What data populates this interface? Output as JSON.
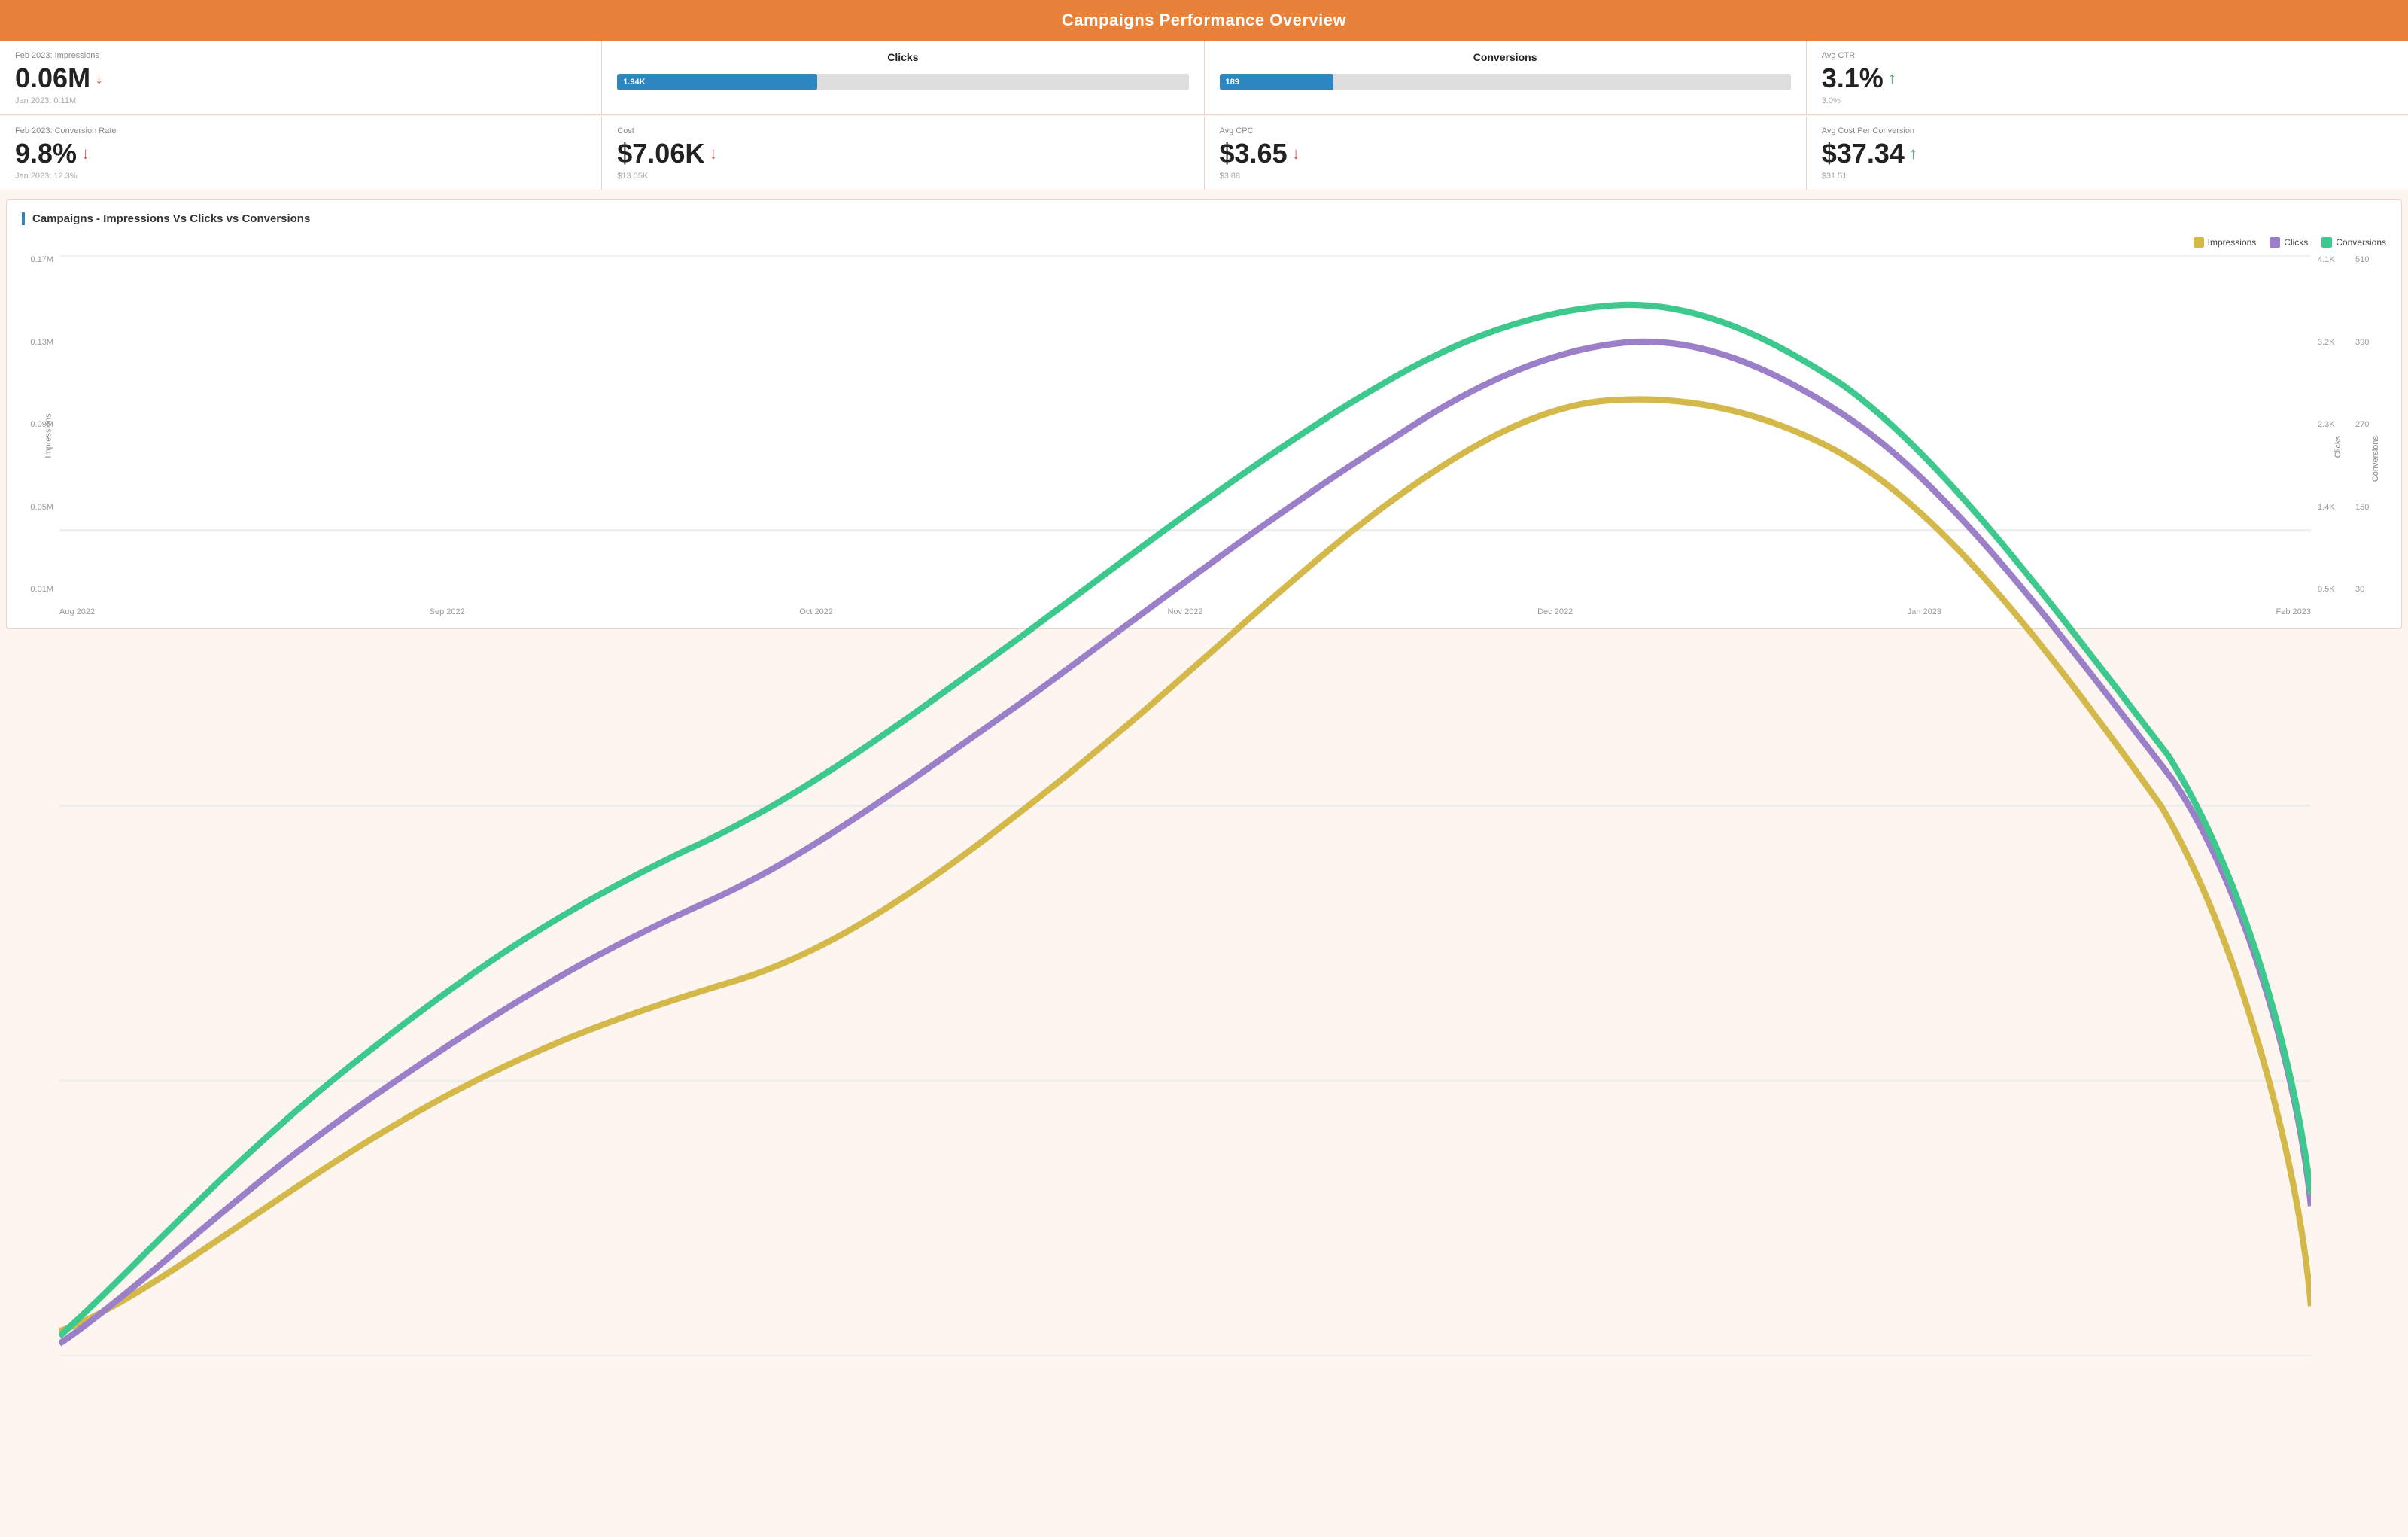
{
  "header": {
    "title": "Campaigns Performance Overview"
  },
  "metrics_row1": [
    {
      "id": "impressions",
      "label": "Feb 2023: Impressions",
      "value": "0.06M",
      "arrow": "down",
      "sub": "Jan 2023: 0.11M",
      "type": "text"
    },
    {
      "id": "clicks",
      "label": "Clicks",
      "bar_value": "1.94K",
      "bar_pct": 35,
      "type": "bar"
    },
    {
      "id": "conversions",
      "label": "Conversions",
      "bar_value": "189",
      "bar_pct": 20,
      "type": "bar"
    },
    {
      "id": "avg_ctr",
      "label": "Avg CTR",
      "value": "3.1%",
      "arrow": "up",
      "sub": "3.0%",
      "type": "text"
    }
  ],
  "metrics_row2": [
    {
      "id": "conversion_rate",
      "label": "Feb 2023: Conversion Rate",
      "value": "9.8%",
      "arrow": "down",
      "sub": "Jan 2023: 12.3%",
      "type": "text"
    },
    {
      "id": "cost",
      "label": "Cost",
      "value": "$7.06K",
      "arrow": "down",
      "sub": "$13.05K",
      "type": "text"
    },
    {
      "id": "avg_cpc",
      "label": "Avg CPC",
      "value": "$3.65",
      "arrow": "down",
      "sub": "$3.88",
      "type": "text"
    },
    {
      "id": "avg_cost_per_conv",
      "label": "Avg Cost Per Conversion",
      "value": "$37.34",
      "arrow": "up",
      "sub": "$31.51",
      "type": "text"
    }
  ],
  "chart": {
    "title": "Campaigns - Impressions Vs Clicks vs Conversions",
    "legend": [
      {
        "label": "Impressions",
        "color": "#d4b94a"
      },
      {
        "label": "Clicks",
        "color": "#9b7fc8"
      },
      {
        "label": "Conversions",
        "color": "#3dc98e"
      }
    ],
    "y_axis_left": [
      "0.17M",
      "0.13M",
      "0.09M",
      "0.05M",
      "0.01M"
    ],
    "y_axis_clicks": [
      "4.1K",
      "3.2K",
      "2.3K",
      "1.4K",
      "0.5K"
    ],
    "y_axis_conv": [
      "510",
      "390",
      "270",
      "150",
      "30"
    ],
    "x_labels": [
      "Aug 2022",
      "Sep 2022",
      "Oct 2022",
      "Nov 2022",
      "Dec 2022",
      "Jan 2023",
      "Feb 2023"
    ],
    "axis_label_left": "Impressions",
    "axis_label_clicks": "Clicks",
    "axis_label_conv": "Conversions"
  }
}
